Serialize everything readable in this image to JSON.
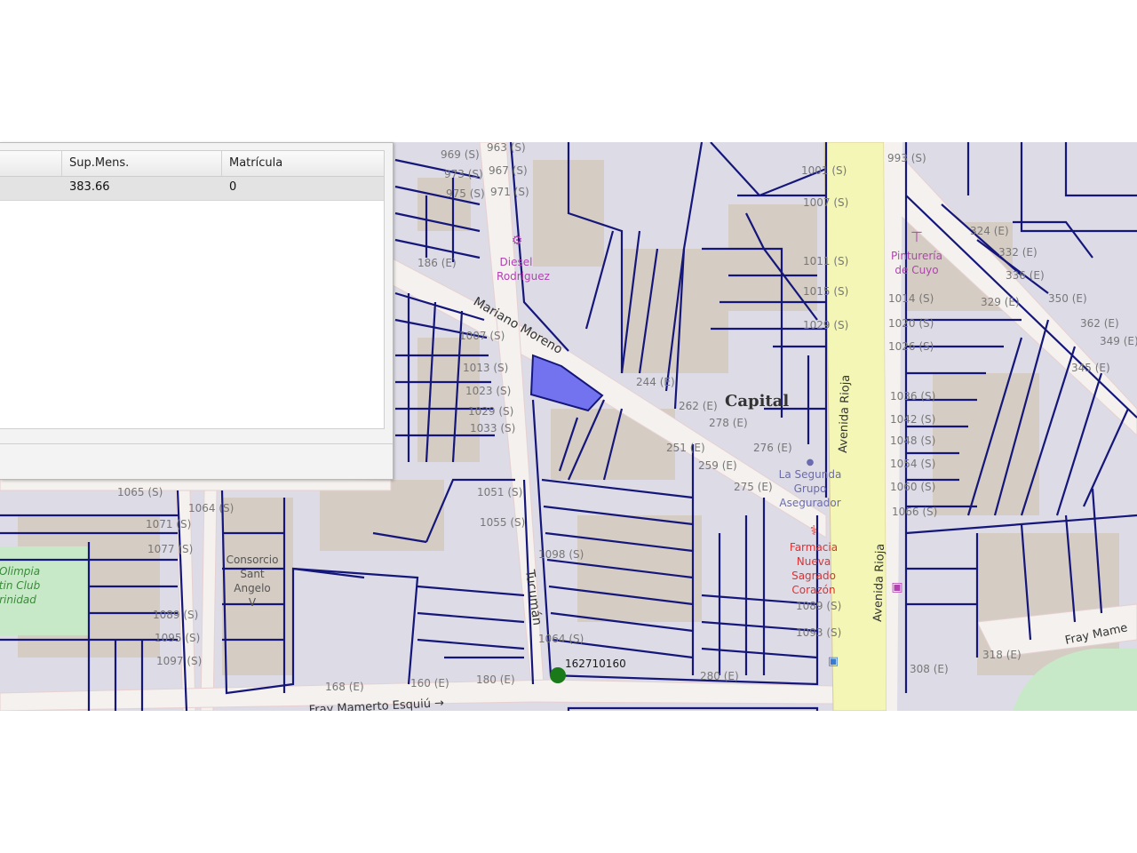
{
  "panel": {
    "columns": [
      "",
      "Sup.Mens.",
      "Matrícula"
    ],
    "rows": [
      [
        "",
        "383.66",
        "0"
      ]
    ]
  },
  "map": {
    "streets": {
      "mariano_moreno": "Mariano Moreno",
      "tucuman": "Tucumán",
      "avenida_rioja_1": "Avenida Rioja",
      "avenida_rioja_2": "Avenida Rioja",
      "fray_mamerto_esquiu": "Fray Mamerto Esquiú →",
      "fray_mamerto_right": "Fray Mame"
    },
    "district_label": "Capital",
    "pois": {
      "diesel": [
        "Diesel",
        "Rodriguez"
      ],
      "pintureria": [
        "Pinturería",
        "de Cuyo"
      ],
      "la_segunda": [
        "La Segunda",
        "Grupo",
        "Asegurador"
      ],
      "farmacia": [
        "Farmacia",
        "Nueva",
        "Sagrado",
        "Corazón"
      ],
      "consorcio": [
        "Consorcio",
        "Sant",
        "Angelo",
        "V"
      ],
      "olimpia": [
        "Olimpia",
        "tin Club",
        "rinidad"
      ]
    },
    "parcel_marker_id": "162710160",
    "house_numbers": {
      "tucuman_left": [
        "1007 (S)",
        "1013 (S)",
        "1023 (S)",
        "1029 (S)",
        "1033 (S)",
        "1051 (S)",
        "1055 (S)"
      ],
      "tucuman_right": [
        "1098 (S)",
        "1064 (S)"
      ],
      "top_col": [
        "969 (S)",
        "973 (S)",
        "975 (S)",
        "963 (S)",
        "967 (S)",
        "971 (S)"
      ],
      "rioja_left": [
        "1001 (S)",
        "1007 (S)",
        "1011 (S)",
        "1015 (S)",
        "1029 (S)",
        "1089 (S)",
        "1093 (S)"
      ],
      "rioja_right": [
        "993 (S)",
        "1014 (S)",
        "1020 (S)",
        "1026 (S)",
        "1036 (S)",
        "1042 (S)",
        "1048 (S)",
        "1054 (S)",
        "1060 (S)",
        "1066 (S)"
      ],
      "left_col": [
        "1065 (S)",
        "1071 (S)",
        "1077 (S)",
        "1089 (S)",
        "1095 (S)",
        "1097 (S)"
      ],
      "left_col2": [
        "1064 (S)"
      ],
      "moreno_nums": [
        "244 (E)",
        "262 (E)",
        "278 (E)",
        "276 (E)",
        "251 (E)",
        "259 (E)",
        "275 (E)"
      ],
      "bottom_nums": [
        "168 (E)",
        "160 (E)",
        "180 (E)",
        "280 (E)",
        "308 (E)",
        "318 (E)"
      ],
      "right_nums": [
        "324 (E)",
        "332 (E)",
        "336 (E)",
        "350 (E)",
        "329 (E)",
        "362 (E)",
        "349 (E)",
        "345 (E)"
      ],
      "misc": [
        "186 (E)"
      ]
    }
  },
  "colors": {
    "parcel_stroke": "#14167a",
    "selected_parcel": "#7373f0",
    "marker": "#1a7a1a",
    "avenue": "#f3f6b5",
    "poi_pink": "#b043b0",
    "poi_red": "#e03030"
  }
}
